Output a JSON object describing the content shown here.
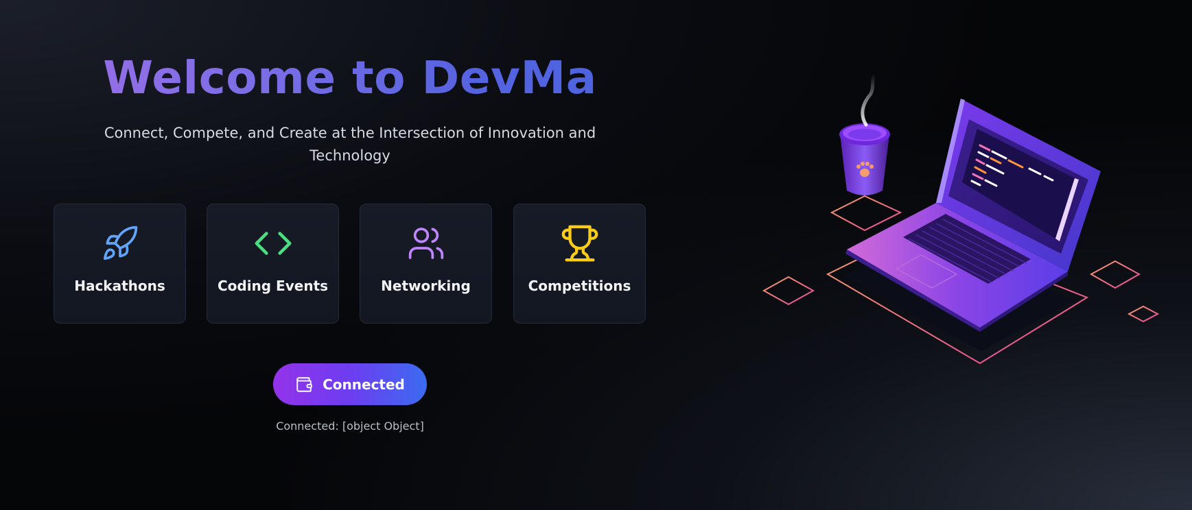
{
  "hero": {
    "title": "Welcome to DevMa",
    "subtitle": "Connect, Compete, and Create at the Intersection of Innovation and Technology"
  },
  "features": [
    {
      "label": "Hackathons",
      "icon": "rocket-icon",
      "color": "#60a5fa"
    },
    {
      "label": "Coding Events",
      "icon": "code-icon",
      "color": "#4ade80"
    },
    {
      "label": "Networking",
      "icon": "users-icon",
      "color": "#c084fc"
    },
    {
      "label": "Competitions",
      "icon": "trophy-icon",
      "color": "#facc15"
    }
  ],
  "wallet": {
    "button_label": "Connected",
    "icon": "wallet-icon",
    "status_text": "Connected: [object Object]"
  },
  "colors": {
    "title_gradient_start": "#9b6ee8",
    "title_gradient_end": "#4a63e0",
    "button_gradient_start": "#9333ea",
    "button_gradient_end": "#3b6cf0"
  }
}
